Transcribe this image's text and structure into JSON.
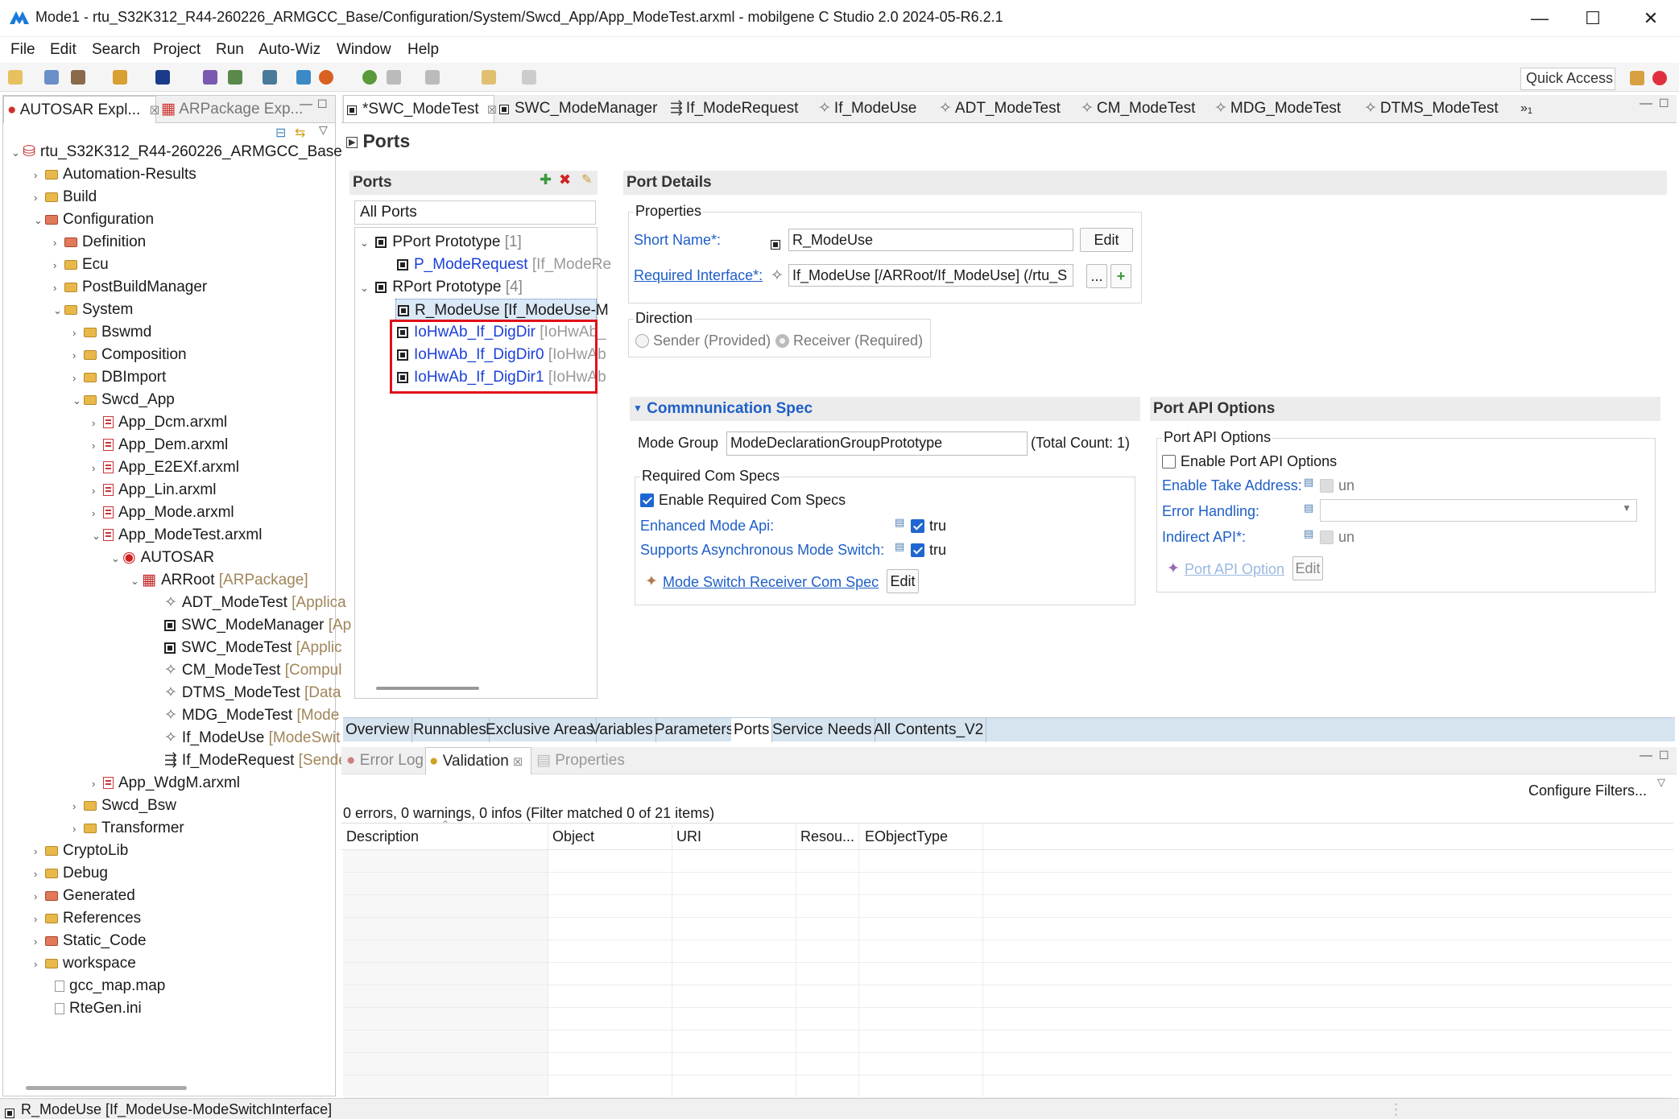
{
  "window": {
    "title": "Mode1 - rtu_S32K312_R44-260226_ARMGCC_Base/Configuration/System/Swcd_App/App_ModeTest.arxml - mobilgene C Studio 2.0 2024-05-R6.2.1",
    "minimize": "—",
    "maximize": "☐",
    "close": "✕"
  },
  "menu": [
    "File",
    "Edit",
    "Search",
    "Project",
    "Run",
    "Auto-Wiz",
    "Window",
    "Help"
  ],
  "quick_access": "Quick Access",
  "left_tabs": {
    "autosar": "AUTOSAR Expl...",
    "arpackage": "ARPackage Exp..."
  },
  "tree": [
    {
      "label": "rtu_S32K312_R44-260226_ARMGCC_Base",
      "suffix": ""
    },
    {
      "label": "Automation-Results",
      "suffix": ""
    },
    {
      "label": "Build",
      "suffix": ""
    },
    {
      "label": "Configuration",
      "suffix": ""
    },
    {
      "label": "Definition",
      "suffix": ""
    },
    {
      "label": "Ecu",
      "suffix": ""
    },
    {
      "label": "PostBuildManager",
      "suffix": ""
    },
    {
      "label": "System",
      "suffix": ""
    },
    {
      "label": "Bswmd",
      "suffix": ""
    },
    {
      "label": "Composition",
      "suffix": ""
    },
    {
      "label": "DBImport",
      "suffix": ""
    },
    {
      "label": "Swcd_App",
      "suffix": ""
    },
    {
      "label": "App_Dcm.arxml",
      "suffix": ""
    },
    {
      "label": "App_Dem.arxml",
      "suffix": ""
    },
    {
      "label": "App_E2EXf.arxml",
      "suffix": ""
    },
    {
      "label": "App_Lin.arxml",
      "suffix": ""
    },
    {
      "label": "App_Mode.arxml",
      "suffix": ""
    },
    {
      "label": "App_ModeTest.arxml",
      "suffix": ""
    },
    {
      "label": "AUTOSAR",
      "suffix": ""
    },
    {
      "label": "ARRoot",
      "suffix": "[ARPackage]"
    },
    {
      "label": "ADT_ModeTest",
      "suffix": "[Applica"
    },
    {
      "label": "SWC_ModeManager",
      "suffix": "[Ap"
    },
    {
      "label": "SWC_ModeTest",
      "suffix": "[Applic"
    },
    {
      "label": "CM_ModeTest",
      "suffix": "[Compul"
    },
    {
      "label": "DTMS_ModeTest",
      "suffix": "[Data"
    },
    {
      "label": "MDG_ModeTest",
      "suffix": "[Mode"
    },
    {
      "label": "If_ModeUse",
      "suffix": "[ModeSwit"
    },
    {
      "label": "If_ModeRequest",
      "suffix": "[Sende"
    },
    {
      "label": "App_WdgM.arxml",
      "suffix": ""
    },
    {
      "label": "Swcd_Bsw",
      "suffix": ""
    },
    {
      "label": "Transformer",
      "suffix": ""
    },
    {
      "label": "CryptoLib",
      "suffix": ""
    },
    {
      "label": "Debug",
      "suffix": ""
    },
    {
      "label": "Generated",
      "suffix": ""
    },
    {
      "label": "References",
      "suffix": ""
    },
    {
      "label": "Static_Code",
      "suffix": ""
    },
    {
      "label": "workspace",
      "suffix": ""
    },
    {
      "label": "gcc_map.map",
      "suffix": ""
    },
    {
      "label": "RteGen.ini",
      "suffix": ""
    }
  ],
  "editor_tabs": [
    "*SWC_ModeTest",
    "SWC_ModeManager",
    "If_ModeRequest",
    "If_ModeUse",
    "ADT_ModeTest",
    "CM_ModeTest",
    "MDG_ModeTest",
    "DTMS_ModeTest"
  ],
  "editor_tabs_more": "»",
  "editor_tabs_more_count": "1",
  "page_title": "Ports",
  "ports": {
    "header": "Ports",
    "filter": "All Ports",
    "pport": {
      "label": "PPort Prototype",
      "count": "[1]"
    },
    "pport_items": [
      {
        "name": "P_ModeRequest",
        "type": "[If_ModeRe"
      }
    ],
    "rport": {
      "label": "RPort Prototype",
      "count": "[4]"
    },
    "rport_items": [
      {
        "name": "R_ModeUse",
        "type": "[If_ModeUse-M"
      },
      {
        "name": "IoHwAb_If_DigDir",
        "type": "[IoHwAb_"
      },
      {
        "name": "IoHwAb_If_DigDir0",
        "type": "[IoHwAb"
      },
      {
        "name": "IoHwAb_If_DigDir1",
        "type": "[IoHwAb"
      }
    ]
  },
  "port_details": {
    "header": "Port Details",
    "properties_title": "Properties",
    "short_name_label": "Short Name*:",
    "short_name_value": "R_ModeUse",
    "edit": "Edit",
    "required_if_label": "Required Interface*:",
    "required_if_value": "If_ModeUse [/ARRoot/If_ModeUse] (/rtu_S",
    "browse": "...",
    "add": "+",
    "direction_title": "Direction",
    "sender": "Sender (Provided)",
    "receiver": "Receiver (Required)"
  },
  "comm_spec": {
    "header": "Commnunication Spec",
    "mode_group_label": "Mode Group",
    "mode_group_value": "ModeDeclarationGroupPrototype",
    "total": "(Total Count: 1)",
    "req_title": "Required Com Specs",
    "enable_label": "Enable Required Com Specs",
    "enhanced_label": "Enhanced Mode Api:",
    "enhanced_value": "tru",
    "async_label": "Supports Asynchronous Mode Switch:",
    "async_value": "tru",
    "receiver_spec": "Mode Switch Receiver Com Spec",
    "edit": "Edit"
  },
  "port_api": {
    "header": "Port API Options",
    "group_title": "Port API Options",
    "enable_label": "Enable Port API Options",
    "take_address": "Enable Take Address:",
    "take_address_value": "un",
    "error_handling": "Error Handling:",
    "indirect": "Indirect API*:",
    "indirect_value": "un",
    "option_link": "Port API Option",
    "edit": "Edit"
  },
  "bottom_tabs": [
    "Overview",
    "Runnables",
    "Exclusive Areas",
    "Variables",
    "Parameters",
    "Ports",
    "Service Needs",
    "All Contents_V2"
  ],
  "lower": {
    "tabs": [
      "Error Log",
      "Validation",
      "Properties"
    ],
    "configure": "Configure Filters...",
    "summary": "0 errors, 0 warnings, 0 infos (Filter matched 0 of 21 items)",
    "columns": [
      "Description",
      "Object",
      "URI",
      "Resou...",
      "EObjectType"
    ]
  },
  "status": "R_ModeUse [If_ModeUse-ModeSwitchInterface]",
  "colors": {
    "accent": "#1e66d0",
    "highlight": "#e0101a",
    "link": "#1a3fd9"
  }
}
